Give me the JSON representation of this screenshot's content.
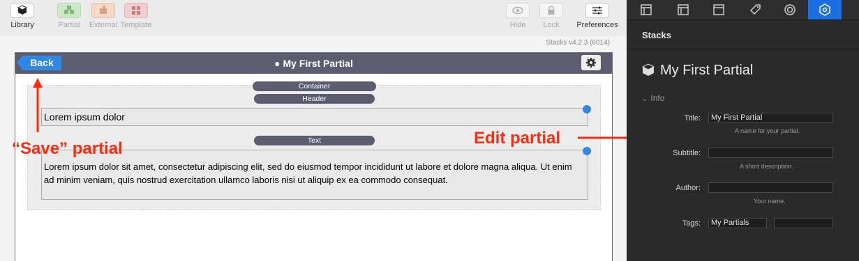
{
  "toolbar": {
    "library": "Library",
    "partial": "Partial",
    "external": "External",
    "template": "Template",
    "hide": "Hide",
    "lock": "Lock",
    "preferences": "Preferences"
  },
  "canvas": {
    "version": "Stacks v4.2.3 (6014)",
    "back": "Back",
    "title": "My First Partial",
    "container_label": "Container",
    "header_label": "Header",
    "header_text": "Lorem ipsum dolor",
    "text_label": "Text",
    "body_text": "Lorem ipsum dolor sit amet, consectetur adipiscing elit, sed do eiusmod tempor incididunt ut labore et dolore magna aliqua. Ut enim ad minim veniam, quis nostrud exercitation ullamco laboris nisi ut aliquip ex ea commodo consequat."
  },
  "annotations": {
    "save": "“Save” partial",
    "edit": "Edit partial",
    "color": "#ff2b0f"
  },
  "inspector": {
    "panel_title": "Stacks",
    "stack_title": "My First Partial",
    "section": "Info",
    "fields": {
      "title_label": "Title:",
      "title_value": "My First Partial",
      "title_hint": "A name for your partial.",
      "subtitle_label": "Subtitle:",
      "subtitle_value": "",
      "subtitle_hint": "A short description.",
      "author_label": "Author:",
      "author_value": "",
      "author_hint": "Your name.",
      "tags_label": "Tags:",
      "tags_value": "My Partials",
      "tags_value2": ""
    },
    "accent": "#1c6fe0"
  }
}
